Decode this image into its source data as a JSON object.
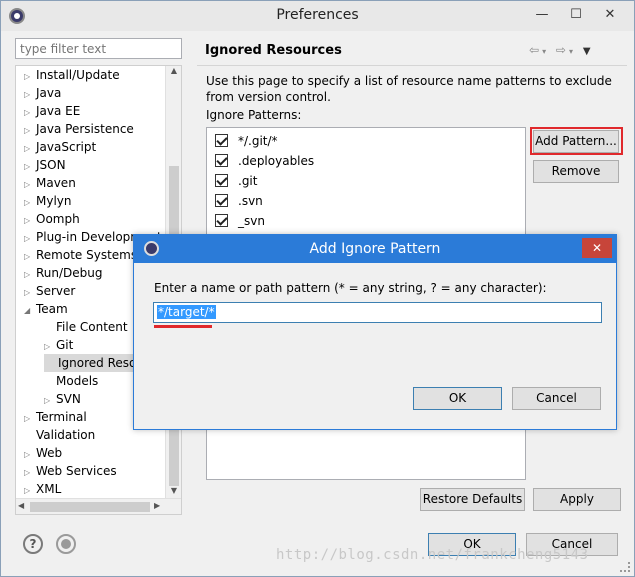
{
  "window": {
    "title": "Preferences",
    "controls": {
      "minimize": "—",
      "maximize": "☐",
      "close": "✕"
    }
  },
  "sidebar": {
    "filter_placeholder": "type filter text",
    "items": [
      {
        "label": "Install/Update",
        "expanded": false,
        "level": 0
      },
      {
        "label": "Java",
        "expanded": false,
        "level": 0
      },
      {
        "label": "Java EE",
        "expanded": false,
        "level": 0
      },
      {
        "label": "Java Persistence",
        "expanded": false,
        "level": 0
      },
      {
        "label": "JavaScript",
        "expanded": false,
        "level": 0
      },
      {
        "label": "JSON",
        "expanded": false,
        "level": 0
      },
      {
        "label": "Maven",
        "expanded": false,
        "level": 0
      },
      {
        "label": "Mylyn",
        "expanded": false,
        "level": 0
      },
      {
        "label": "Oomph",
        "expanded": false,
        "level": 0
      },
      {
        "label": "Plug-in Development",
        "expanded": false,
        "level": 0
      },
      {
        "label": "Remote Systems",
        "expanded": false,
        "level": 0
      },
      {
        "label": "Run/Debug",
        "expanded": false,
        "level": 0
      },
      {
        "label": "Server",
        "expanded": false,
        "level": 0
      },
      {
        "label": "Team",
        "expanded": true,
        "level": 0
      },
      {
        "label": "File Content",
        "level": 1
      },
      {
        "label": "Git",
        "expanded": false,
        "level": 1
      },
      {
        "label": "Ignored Reso",
        "level": 1,
        "selected": true
      },
      {
        "label": "Models",
        "level": 1
      },
      {
        "label": "SVN",
        "expanded": false,
        "level": 1
      },
      {
        "label": "Terminal",
        "expanded": false,
        "level": 0
      },
      {
        "label": "Validation",
        "level": 0
      },
      {
        "label": "Web",
        "expanded": false,
        "level": 0
      },
      {
        "label": "Web Services",
        "expanded": false,
        "level": 0
      },
      {
        "label": "XML",
        "expanded": false,
        "level": 0
      }
    ]
  },
  "page": {
    "title": "Ignored Resources",
    "description": "Use this page to specify a list of resource name patterns to exclude from version control.",
    "patterns_label": "Ignore Patterns:",
    "patterns": [
      {
        "label": "*/.git/*",
        "checked": true
      },
      {
        "label": ".deployables",
        "checked": true
      },
      {
        "label": ".git",
        "checked": true
      },
      {
        "label": ".svn",
        "checked": true
      },
      {
        "label": "_svn",
        "checked": true
      }
    ],
    "add_pattern_label": "Add Pattern...",
    "remove_label": "Remove",
    "restore_defaults_label": "Restore Defaults",
    "apply_label": "Apply",
    "ok_label": "OK",
    "cancel_label": "Cancel"
  },
  "dialog": {
    "title": "Add Ignore Pattern",
    "prompt": "Enter a name or path pattern (* = any string, ? = any character):",
    "input_value": "*/target/*",
    "ok_label": "OK",
    "cancel_label": "Cancel",
    "close_glyph": "✕"
  },
  "watermark": "http://blog.csdn.net/frankcheng5143",
  "colors": {
    "highlight": "#e0292c",
    "dialog_title": "#2b7bd8",
    "selection": "#3399ff"
  },
  "icons": [
    "eclipse-app-icon",
    "help-icon",
    "record-icon",
    "back-arrow-icon",
    "forward-arrow-icon",
    "menu-dropdown-icon"
  ]
}
